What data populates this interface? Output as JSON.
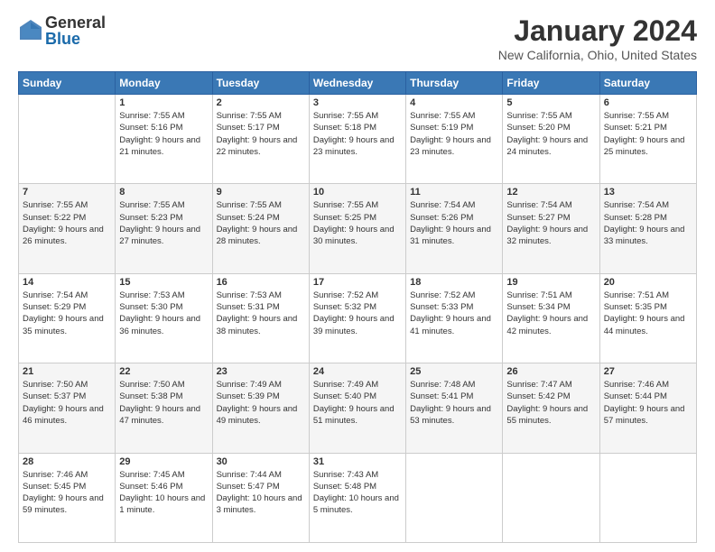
{
  "logo": {
    "general": "General",
    "blue": "Blue"
  },
  "title": "January 2024",
  "subtitle": "New California, Ohio, United States",
  "weekdays": [
    "Sunday",
    "Monday",
    "Tuesday",
    "Wednesday",
    "Thursday",
    "Friday",
    "Saturday"
  ],
  "weeks": [
    [
      {
        "day": "",
        "sunrise": "",
        "sunset": "",
        "daylight": ""
      },
      {
        "day": "1",
        "sunrise": "Sunrise: 7:55 AM",
        "sunset": "Sunset: 5:16 PM",
        "daylight": "Daylight: 9 hours and 21 minutes."
      },
      {
        "day": "2",
        "sunrise": "Sunrise: 7:55 AM",
        "sunset": "Sunset: 5:17 PM",
        "daylight": "Daylight: 9 hours and 22 minutes."
      },
      {
        "day": "3",
        "sunrise": "Sunrise: 7:55 AM",
        "sunset": "Sunset: 5:18 PM",
        "daylight": "Daylight: 9 hours and 23 minutes."
      },
      {
        "day": "4",
        "sunrise": "Sunrise: 7:55 AM",
        "sunset": "Sunset: 5:19 PM",
        "daylight": "Daylight: 9 hours and 23 minutes."
      },
      {
        "day": "5",
        "sunrise": "Sunrise: 7:55 AM",
        "sunset": "Sunset: 5:20 PM",
        "daylight": "Daylight: 9 hours and 24 minutes."
      },
      {
        "day": "6",
        "sunrise": "Sunrise: 7:55 AM",
        "sunset": "Sunset: 5:21 PM",
        "daylight": "Daylight: 9 hours and 25 minutes."
      }
    ],
    [
      {
        "day": "7",
        "sunrise": "Sunrise: 7:55 AM",
        "sunset": "Sunset: 5:22 PM",
        "daylight": "Daylight: 9 hours and 26 minutes."
      },
      {
        "day": "8",
        "sunrise": "Sunrise: 7:55 AM",
        "sunset": "Sunset: 5:23 PM",
        "daylight": "Daylight: 9 hours and 27 minutes."
      },
      {
        "day": "9",
        "sunrise": "Sunrise: 7:55 AM",
        "sunset": "Sunset: 5:24 PM",
        "daylight": "Daylight: 9 hours and 28 minutes."
      },
      {
        "day": "10",
        "sunrise": "Sunrise: 7:55 AM",
        "sunset": "Sunset: 5:25 PM",
        "daylight": "Daylight: 9 hours and 30 minutes."
      },
      {
        "day": "11",
        "sunrise": "Sunrise: 7:54 AM",
        "sunset": "Sunset: 5:26 PM",
        "daylight": "Daylight: 9 hours and 31 minutes."
      },
      {
        "day": "12",
        "sunrise": "Sunrise: 7:54 AM",
        "sunset": "Sunset: 5:27 PM",
        "daylight": "Daylight: 9 hours and 32 minutes."
      },
      {
        "day": "13",
        "sunrise": "Sunrise: 7:54 AM",
        "sunset": "Sunset: 5:28 PM",
        "daylight": "Daylight: 9 hours and 33 minutes."
      }
    ],
    [
      {
        "day": "14",
        "sunrise": "Sunrise: 7:54 AM",
        "sunset": "Sunset: 5:29 PM",
        "daylight": "Daylight: 9 hours and 35 minutes."
      },
      {
        "day": "15",
        "sunrise": "Sunrise: 7:53 AM",
        "sunset": "Sunset: 5:30 PM",
        "daylight": "Daylight: 9 hours and 36 minutes."
      },
      {
        "day": "16",
        "sunrise": "Sunrise: 7:53 AM",
        "sunset": "Sunset: 5:31 PM",
        "daylight": "Daylight: 9 hours and 38 minutes."
      },
      {
        "day": "17",
        "sunrise": "Sunrise: 7:52 AM",
        "sunset": "Sunset: 5:32 PM",
        "daylight": "Daylight: 9 hours and 39 minutes."
      },
      {
        "day": "18",
        "sunrise": "Sunrise: 7:52 AM",
        "sunset": "Sunset: 5:33 PM",
        "daylight": "Daylight: 9 hours and 41 minutes."
      },
      {
        "day": "19",
        "sunrise": "Sunrise: 7:51 AM",
        "sunset": "Sunset: 5:34 PM",
        "daylight": "Daylight: 9 hours and 42 minutes."
      },
      {
        "day": "20",
        "sunrise": "Sunrise: 7:51 AM",
        "sunset": "Sunset: 5:35 PM",
        "daylight": "Daylight: 9 hours and 44 minutes."
      }
    ],
    [
      {
        "day": "21",
        "sunrise": "Sunrise: 7:50 AM",
        "sunset": "Sunset: 5:37 PM",
        "daylight": "Daylight: 9 hours and 46 minutes."
      },
      {
        "day": "22",
        "sunrise": "Sunrise: 7:50 AM",
        "sunset": "Sunset: 5:38 PM",
        "daylight": "Daylight: 9 hours and 47 minutes."
      },
      {
        "day": "23",
        "sunrise": "Sunrise: 7:49 AM",
        "sunset": "Sunset: 5:39 PM",
        "daylight": "Daylight: 9 hours and 49 minutes."
      },
      {
        "day": "24",
        "sunrise": "Sunrise: 7:49 AM",
        "sunset": "Sunset: 5:40 PM",
        "daylight": "Daylight: 9 hours and 51 minutes."
      },
      {
        "day": "25",
        "sunrise": "Sunrise: 7:48 AM",
        "sunset": "Sunset: 5:41 PM",
        "daylight": "Daylight: 9 hours and 53 minutes."
      },
      {
        "day": "26",
        "sunrise": "Sunrise: 7:47 AM",
        "sunset": "Sunset: 5:42 PM",
        "daylight": "Daylight: 9 hours and 55 minutes."
      },
      {
        "day": "27",
        "sunrise": "Sunrise: 7:46 AM",
        "sunset": "Sunset: 5:44 PM",
        "daylight": "Daylight: 9 hours and 57 minutes."
      }
    ],
    [
      {
        "day": "28",
        "sunrise": "Sunrise: 7:46 AM",
        "sunset": "Sunset: 5:45 PM",
        "daylight": "Daylight: 9 hours and 59 minutes."
      },
      {
        "day": "29",
        "sunrise": "Sunrise: 7:45 AM",
        "sunset": "Sunset: 5:46 PM",
        "daylight": "Daylight: 10 hours and 1 minute."
      },
      {
        "day": "30",
        "sunrise": "Sunrise: 7:44 AM",
        "sunset": "Sunset: 5:47 PM",
        "daylight": "Daylight: 10 hours and 3 minutes."
      },
      {
        "day": "31",
        "sunrise": "Sunrise: 7:43 AM",
        "sunset": "Sunset: 5:48 PM",
        "daylight": "Daylight: 10 hours and 5 minutes."
      },
      {
        "day": "",
        "sunrise": "",
        "sunset": "",
        "daylight": ""
      },
      {
        "day": "",
        "sunrise": "",
        "sunset": "",
        "daylight": ""
      },
      {
        "day": "",
        "sunrise": "",
        "sunset": "",
        "daylight": ""
      }
    ]
  ]
}
